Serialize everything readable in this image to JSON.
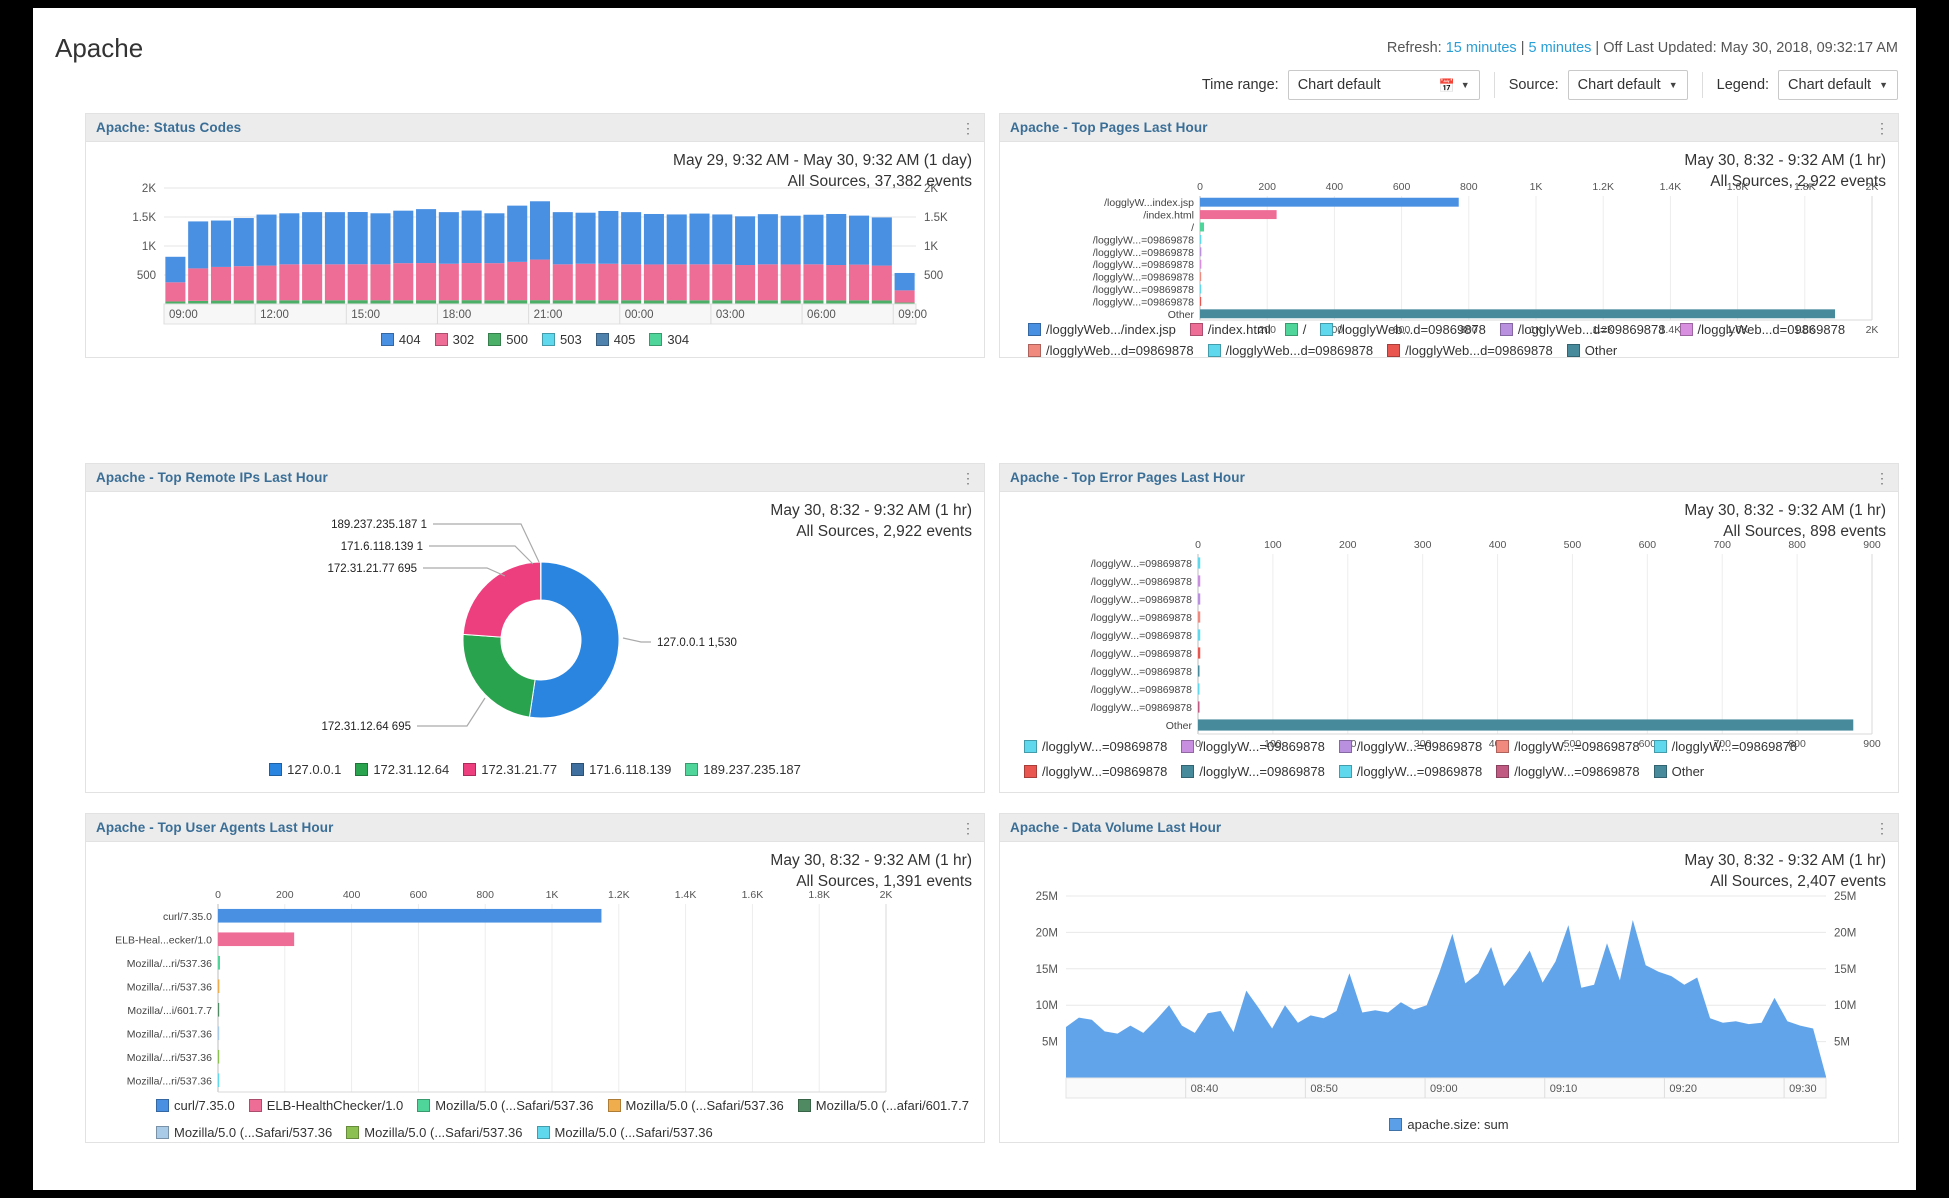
{
  "header": {
    "title": "Apache",
    "refresh_label": "Refresh:",
    "refresh_opt_1": "15 minutes",
    "refresh_sep": "|",
    "refresh_opt_2": "5 minutes",
    "refresh_off": "Off",
    "last_updated": "Last Updated: May 30, 2018, 09:32:17 AM",
    "time_range_label": "Time range:",
    "time_range_value": "Chart default",
    "source_label": "Source:",
    "source_value": "Chart default",
    "legend_label": "Legend:",
    "legend_value": "Chart default"
  },
  "panels": {
    "status_codes": {
      "title": "Apache: Status Codes",
      "range": "May 29, 9:32 AM - May 30, 9:32 AM  (1 day)",
      "sources": "All Sources, 37,382 events"
    },
    "top_pages": {
      "title": "Apache - Top Pages Last Hour",
      "range": "May 30, 8:32 - 9:32 AM  (1 hr)",
      "sources": "All Sources, 2,922 events"
    },
    "top_remote_ips": {
      "title": "Apache - Top Remote IPs Last Hour",
      "range": "May 30, 8:32 - 9:32 AM  (1 hr)",
      "sources": "All Sources, 2,922 events"
    },
    "top_error_pages": {
      "title": "Apache - Top Error Pages Last Hour",
      "range": "May 30, 8:32 - 9:32 AM  (1 hr)",
      "sources": "All Sources, 898 events"
    },
    "top_user_agents": {
      "title": "Apache - Top User Agents Last Hour",
      "range": "May 30, 8:32 - 9:32 AM  (1 hr)",
      "sources": "All Sources, 1,391 events"
    },
    "data_volume": {
      "title": "Apache - Data Volume Last Hour",
      "range": "May 30, 8:32 - 9:32 AM  (1 hr)",
      "sources": "All Sources, 2,407 events"
    }
  },
  "chart_data": [
    {
      "id": "status_codes",
      "type": "bar",
      "stacked": true,
      "title": "Apache: Status Codes",
      "xlabel": "",
      "ylabel": "",
      "ylim": [
        0,
        2000
      ],
      "ytick_labels": [
        "500",
        "1K",
        "1.5K",
        "2K"
      ],
      "ytick_values": [
        500,
        1000,
        1500,
        2000
      ],
      "xtick_labels": [
        "09:00",
        "12:00",
        "15:00",
        "18:00",
        "21:00",
        "00:00",
        "03:00",
        "06:00",
        "09:00"
      ],
      "grid": true,
      "legend_position": "bottom",
      "legend": [
        "404",
        "302",
        "500",
        "503",
        "405",
        "304"
      ],
      "colors": [
        "#4a90e2",
        "#ee6d97",
        "#4caf68",
        "#5fd8ee",
        "#4f82ad",
        "#4fd49a"
      ],
      "x": [
        "09:00",
        "09:45",
        "10:30",
        "11:15",
        "12:00",
        "12:45",
        "13:30",
        "14:15",
        "15:00",
        "15:45",
        "16:30",
        "17:15",
        "18:00",
        "18:45",
        "19:30",
        "20:15",
        "21:00",
        "21:45",
        "22:30",
        "23:15",
        "00:00",
        "00:45",
        "01:30",
        "02:15",
        "03:00",
        "03:45",
        "04:30",
        "05:15",
        "06:00",
        "06:45",
        "07:30",
        "08:15",
        "09:00"
      ],
      "series": [
        {
          "name": "404",
          "values": [
            440,
            810,
            800,
            830,
            880,
            880,
            900,
            900,
            900,
            880,
            905,
            930,
            890,
            905,
            860,
            970,
            1005,
            900,
            880,
            910,
            900,
            870,
            860,
            875,
            860,
            840,
            865,
            840,
            855,
            880,
            845,
            830,
            300
          ]
        },
        {
          "name": "302",
          "values": [
            330,
            560,
            580,
            590,
            600,
            620,
            620,
            620,
            620,
            620,
            640,
            640,
            630,
            640,
            640,
            660,
            700,
            620,
            630,
            630,
            620,
            620,
            620,
            620,
            620,
            610,
            620,
            620,
            620,
            610,
            615,
            600,
            210
          ]
        },
        {
          "name": "500",
          "values": [
            40,
            50,
            55,
            58,
            58,
            60,
            60,
            60,
            62,
            60,
            60,
            62,
            60,
            62,
            60,
            62,
            62,
            60,
            60,
            60,
            60,
            58,
            60,
            60,
            60,
            58,
            60,
            58,
            60,
            58,
            60,
            58,
            22
          ]
        },
        {
          "name": "503",
          "values": [
            2,
            2,
            2,
            2,
            2,
            2,
            2,
            2,
            2,
            2,
            2,
            2,
            2,
            2,
            2,
            2,
            2,
            2,
            2,
            2,
            2,
            2,
            2,
            2,
            2,
            2,
            2,
            2,
            2,
            2,
            2,
            2,
            1
          ]
        },
        {
          "name": "405",
          "values": [
            1,
            1,
            1,
            1,
            1,
            1,
            1,
            1,
            1,
            1,
            1,
            1,
            1,
            1,
            1,
            1,
            1,
            1,
            1,
            1,
            1,
            1,
            1,
            1,
            1,
            1,
            1,
            1,
            1,
            1,
            1,
            1,
            1
          ]
        },
        {
          "name": "304",
          "values": [
            1,
            1,
            1,
            1,
            1,
            1,
            1,
            1,
            1,
            1,
            1,
            1,
            1,
            1,
            1,
            1,
            1,
            1,
            1,
            1,
            1,
            1,
            1,
            1,
            1,
            1,
            1,
            1,
            1,
            1,
            1,
            1,
            1
          ]
        }
      ]
    },
    {
      "id": "top_pages",
      "type": "bar",
      "orientation": "horizontal",
      "title": "Apache - Top Pages Last Hour",
      "xlim": [
        0,
        2000
      ],
      "xtick_labels": [
        "0",
        "200",
        "400",
        "600",
        "800",
        "1K",
        "1.2K",
        "1.4K",
        "1.6K",
        "1.8K",
        "2K"
      ],
      "xtick_values": [
        0,
        200,
        400,
        600,
        800,
        1000,
        1200,
        1400,
        1600,
        1800,
        2000
      ],
      "grid": true,
      "legend_position": "bottom",
      "categories": [
        "/logglyW...index.jsp",
        "/index.html",
        "/",
        "/logglyW...=09869878",
        "/logglyW...=09869878",
        "/logglyW...=09869878",
        "/logglyW...=09869878",
        "/logglyW...=09869878",
        "/logglyW...=09869878",
        "Other"
      ],
      "values": [
        770,
        228,
        12,
        4,
        4,
        4,
        3,
        3,
        3,
        1890
      ],
      "colors": [
        "#4a90e2",
        "#ee6d97",
        "#4fd49a",
        "#5fd8ee",
        "#b98fe0",
        "#d98fe0",
        "#f08a7f",
        "#5fd8ee",
        "#e8564f",
        "#468a9c"
      ],
      "legend": [
        "/logglyWeb.../index.jsp",
        "/index.html",
        "/",
        "/logglyWeb...d=09869878",
        "/logglyWeb...d=09869878",
        "/logglyWeb...d=09869878",
        "/logglyWeb...d=09869878",
        "/logglyWeb...d=09869878",
        "/logglyWeb...d=09869878",
        "Other"
      ]
    },
    {
      "id": "top_remote_ips",
      "type": "pie",
      "donut": true,
      "title": "Apache - Top Remote IPs Last Hour",
      "labels": [
        "127.0.0.1",
        "172.31.12.64",
        "172.31.21.77",
        "171.6.118.139",
        "189.237.235.187"
      ],
      "values": [
        1530,
        695,
        695,
        1,
        1
      ],
      "colors": [
        "#2a85e0",
        "#2aa34e",
        "#ed3e7e",
        "#3e6f9e",
        "#4fd49a"
      ],
      "callouts": [
        "127.0.0.1 1,530",
        "172.31.12.64 695",
        "172.31.21.77 695",
        "171.6.118.139 1",
        "189.237.235.187 1"
      ],
      "legend_position": "bottom",
      "legend": [
        "127.0.0.1",
        "172.31.12.64",
        "172.31.21.77",
        "171.6.118.139",
        "189.237.235.187"
      ]
    },
    {
      "id": "top_error_pages",
      "type": "bar",
      "orientation": "horizontal",
      "title": "Apache - Top Error Pages Last Hour",
      "xlim": [
        0,
        900
      ],
      "xtick_labels": [
        "0",
        "100",
        "200",
        "300",
        "400",
        "500",
        "600",
        "700",
        "800",
        "900"
      ],
      "xtick_values": [
        0,
        100,
        200,
        300,
        400,
        500,
        600,
        700,
        800,
        900
      ],
      "grid": true,
      "legend_position": "bottom",
      "categories": [
        "/logglyW...=09869878",
        "/logglyW...=09869878",
        "/logglyW...=09869878",
        "/logglyW...=09869878",
        "/logglyW...=09869878",
        "/logglyW...=09869878",
        "/logglyW...=09869878",
        "/logglyW...=09869878",
        "/logglyW...=09869878",
        "Other"
      ],
      "values": [
        3,
        3,
        3,
        3,
        3,
        3,
        2,
        2,
        2,
        875
      ],
      "colors": [
        "#5fd8ee",
        "#c88fe0",
        "#b98fe0",
        "#f08a7f",
        "#5fd8ee",
        "#e8564f",
        "#468a9c",
        "#5fd8ee",
        "#c05a82",
        "#468a9c"
      ],
      "legend": [
        "/logglyW...=09869878",
        "/logglyW...=09869878",
        "/logglyW...=09869878",
        "/logglyW...=09869878",
        "/logglyW...=09869878",
        "/logglyW...=09869878",
        "/logglyW...=09869878",
        "/logglyW...=09869878",
        "/logglyW...=09869878",
        "Other"
      ]
    },
    {
      "id": "top_user_agents",
      "type": "bar",
      "orientation": "horizontal",
      "title": "Apache - Top User Agents Last Hour",
      "xlim": [
        0,
        2000
      ],
      "xtick_labels": [
        "0",
        "200",
        "400",
        "600",
        "800",
        "1K",
        "1.2K",
        "1.4K",
        "1.6K",
        "1.8K",
        "2K"
      ],
      "xtick_values": [
        0,
        200,
        400,
        600,
        800,
        1000,
        1200,
        1400,
        1600,
        1800,
        2000
      ],
      "grid": true,
      "legend_position": "bottom",
      "categories": [
        "curl/7.35.0",
        "ELB-Heal...ecker/1.0",
        "Mozilla/...ri/537.36",
        "Mozilla/...ri/537.36",
        "Mozilla/...i/601.7.7",
        "Mozilla/...ri/537.36",
        "Mozilla/...ri/537.36",
        "Mozilla/...ri/537.36"
      ],
      "values": [
        1148,
        228,
        6,
        4,
        3,
        3,
        3,
        3
      ],
      "colors": [
        "#4a90e2",
        "#ee6d97",
        "#4fd49a",
        "#f0ad4e",
        "#4f8a63",
        "#a9cbe8",
        "#8cc152",
        "#5fd8ee"
      ],
      "legend": [
        "curl/7.35.0",
        "ELB-HealthChecker/1.0",
        "Mozilla/5.0 (...Safari/537.36",
        "Mozilla/5.0 (...Safari/537.36",
        "Mozilla/5.0 (...afari/601.7.7",
        "Mozilla/5.0 (...Safari/537.36",
        "Mozilla/5.0 (...Safari/537.36",
        "Mozilla/5.0 (...Safari/537.36"
      ]
    },
    {
      "id": "data_volume",
      "type": "area",
      "title": "Apache - Data Volume Last Hour",
      "ylim": [
        0,
        25000000
      ],
      "ytick_labels": [
        "5M",
        "10M",
        "15M",
        "20M",
        "25M"
      ],
      "ytick_values": [
        5000000,
        10000000,
        15000000,
        20000000,
        25000000
      ],
      "xtick_labels": [
        "08:40",
        "08:50",
        "09:00",
        "09:10",
        "09:20",
        "09:30"
      ],
      "grid": true,
      "legend_position": "bottom",
      "legend": [
        "apache.size: sum"
      ],
      "colors": [
        "#5a9fe8"
      ],
      "series_name": "apache.size: sum",
      "values": [
        7.0,
        8.3,
        8.0,
        6.4,
        6.1,
        7.2,
        6.2,
        8.0,
        10.0,
        7.2,
        6.2,
        8.9,
        9.2,
        6.3,
        12.0,
        9.5,
        6.8,
        10.0,
        7.6,
        8.6,
        8.2,
        9.2,
        14.4,
        9.0,
        9.3,
        9.0,
        10.4,
        9.4,
        10.0,
        14.6,
        19.8,
        13.0,
        14.4,
        18.0,
        12.6,
        14.8,
        17.5,
        13.1,
        16.0,
        21.0,
        12.4,
        12.8,
        18.5,
        13.4,
        21.7,
        15.5,
        14.6,
        14.0,
        12.8,
        13.8,
        8.2,
        7.6,
        7.8,
        7.4,
        7.6,
        11.0,
        7.8,
        7.2,
        6.8,
        0.2
      ],
      "value_unit": "M"
    }
  ]
}
